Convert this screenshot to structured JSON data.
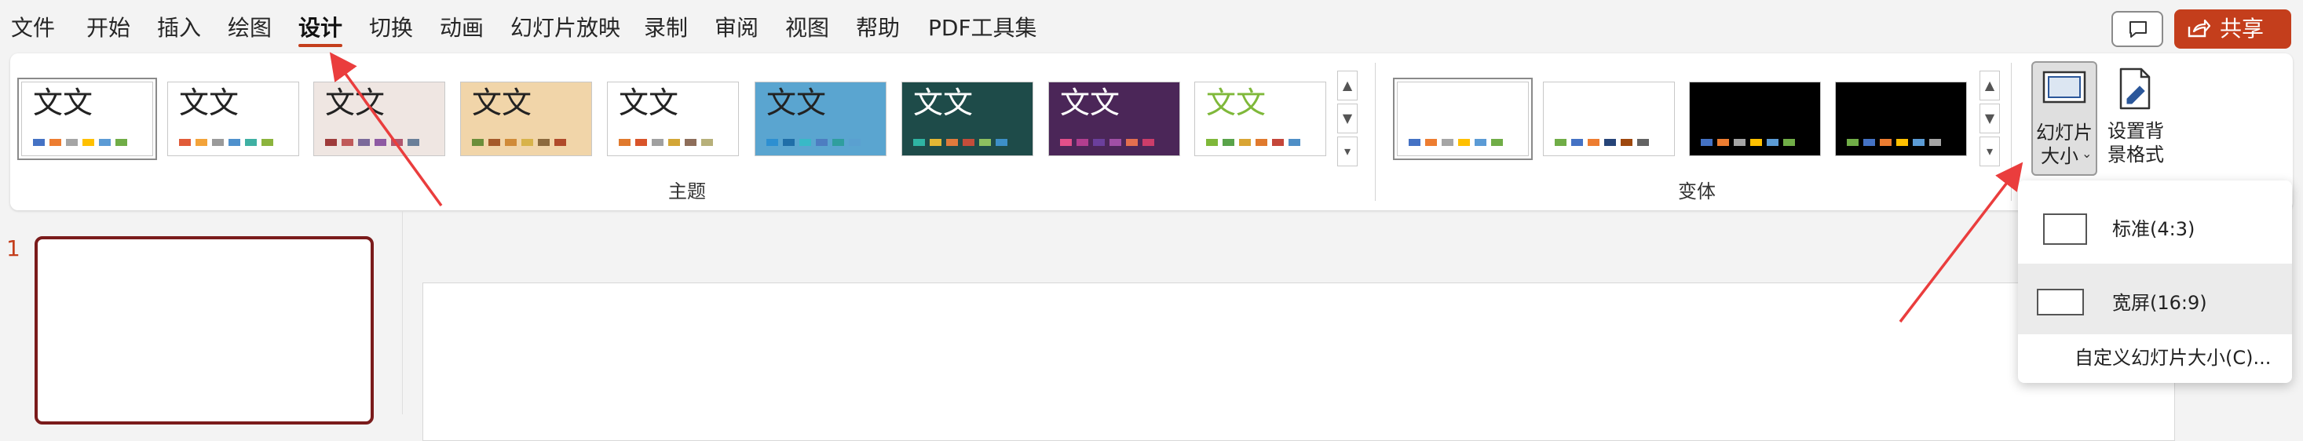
{
  "menu": {
    "items": [
      "文件",
      "开始",
      "插入",
      "绘图",
      "设计",
      "切换",
      "动画",
      "幻灯片放映",
      "录制",
      "审阅",
      "视图",
      "帮助",
      "PDF工具集"
    ],
    "active": "设计",
    "share_label": "共享"
  },
  "ribbon": {
    "themes_label": "主题",
    "variants_label": "变体",
    "theme_thumb_text": "文文",
    "slide_size_label_line1": "幻灯片",
    "slide_size_label_line2": "大小",
    "format_bg_label_line1": "设置背",
    "format_bg_label_line2": "景格式"
  },
  "themes": [
    {
      "bg": "#ffffff",
      "text_color": "#222222",
      "swatches": [
        "#4472c4",
        "#ed7d31",
        "#a5a5a5",
        "#ffc000",
        "#5b9bd5",
        "#70ad47"
      ]
    },
    {
      "bg": "#ffffff",
      "text_color": "#222222",
      "swatches": [
        "#e15b39",
        "#f3a33a",
        "#9a9a9a",
        "#4f91cd",
        "#3fb0a3",
        "#8cb43d"
      ]
    },
    {
      "bg": "#efe6e2",
      "text_color": "#222222",
      "swatches": [
        "#9e3b3b",
        "#c05a5a",
        "#7b6a9a",
        "#8e5aa3",
        "#b0566e",
        "#6a7f99"
      ]
    },
    {
      "bg": "#f1d5a9",
      "text_color": "#222222",
      "swatches": [
        "#6b8e3a",
        "#a55a2a",
        "#d08b39",
        "#d8b34a",
        "#8c6a3e",
        "#b04a2a"
      ]
    },
    {
      "bg": "#ffffff",
      "text_color": "#222222",
      "swatches": [
        "#e07a2e",
        "#d9542a",
        "#a0a0a0",
        "#d3a637",
        "#8e6e5a",
        "#b7b07a"
      ]
    },
    {
      "bg": "#5aa5d0",
      "text_color": "#222222",
      "swatches": [
        "#2d8fd1",
        "#1f6ea8",
        "#38b9c7",
        "#4d7dc1",
        "#2f9e9e",
        "#5aa0d0"
      ]
    },
    {
      "bg": "#1e4b49",
      "text_color": "#ffffff",
      "swatches": [
        "#2fb4a3",
        "#e4b734",
        "#e07a3c",
        "#c44d3a",
        "#8dc060",
        "#3d8fc7"
      ]
    },
    {
      "bg": "#4b2658",
      "text_color": "#ffffff",
      "swatches": [
        "#e24f8a",
        "#b23e8f",
        "#6b3f9c",
        "#a04fa5",
        "#e36f4f",
        "#cc3d6a"
      ]
    },
    {
      "bg": "#ffffff",
      "text_color": "#7fb83a",
      "swatches": [
        "#7fb83a",
        "#59a34a",
        "#d9a534",
        "#e07a2e",
        "#c4463a",
        "#4f8fc7"
      ]
    }
  ],
  "variants": [
    {
      "bg": "#ffffff",
      "swatches": [
        "#4472c4",
        "#ed7d31",
        "#a5a5a5",
        "#ffc000",
        "#5b9bd5",
        "#70ad47"
      ]
    },
    {
      "bg": "#ffffff",
      "swatches": [
        "#70ad47",
        "#4472c4",
        "#ed7d31",
        "#264478",
        "#9e480e",
        "#636363"
      ]
    },
    {
      "bg": "#000000",
      "swatches": [
        "#4472c4",
        "#ed7d31",
        "#a5a5a5",
        "#ffc000",
        "#5b9bd5",
        "#70ad47"
      ]
    },
    {
      "bg": "#000000",
      "swatches": [
        "#70ad47",
        "#4472c4",
        "#ed7d31",
        "#ffc000",
        "#5b9bd5",
        "#a5a5a5"
      ]
    }
  ],
  "slide_panel": {
    "number": "1"
  },
  "dropdown": {
    "standard_label": "标准(4:3)",
    "widescreen_label": "宽屏(16:9)",
    "custom_label": "自定义幻灯片大小(C)..."
  },
  "colors": {
    "accent": "#c43e1c",
    "annotation_arrow": "#ea3d3d"
  }
}
